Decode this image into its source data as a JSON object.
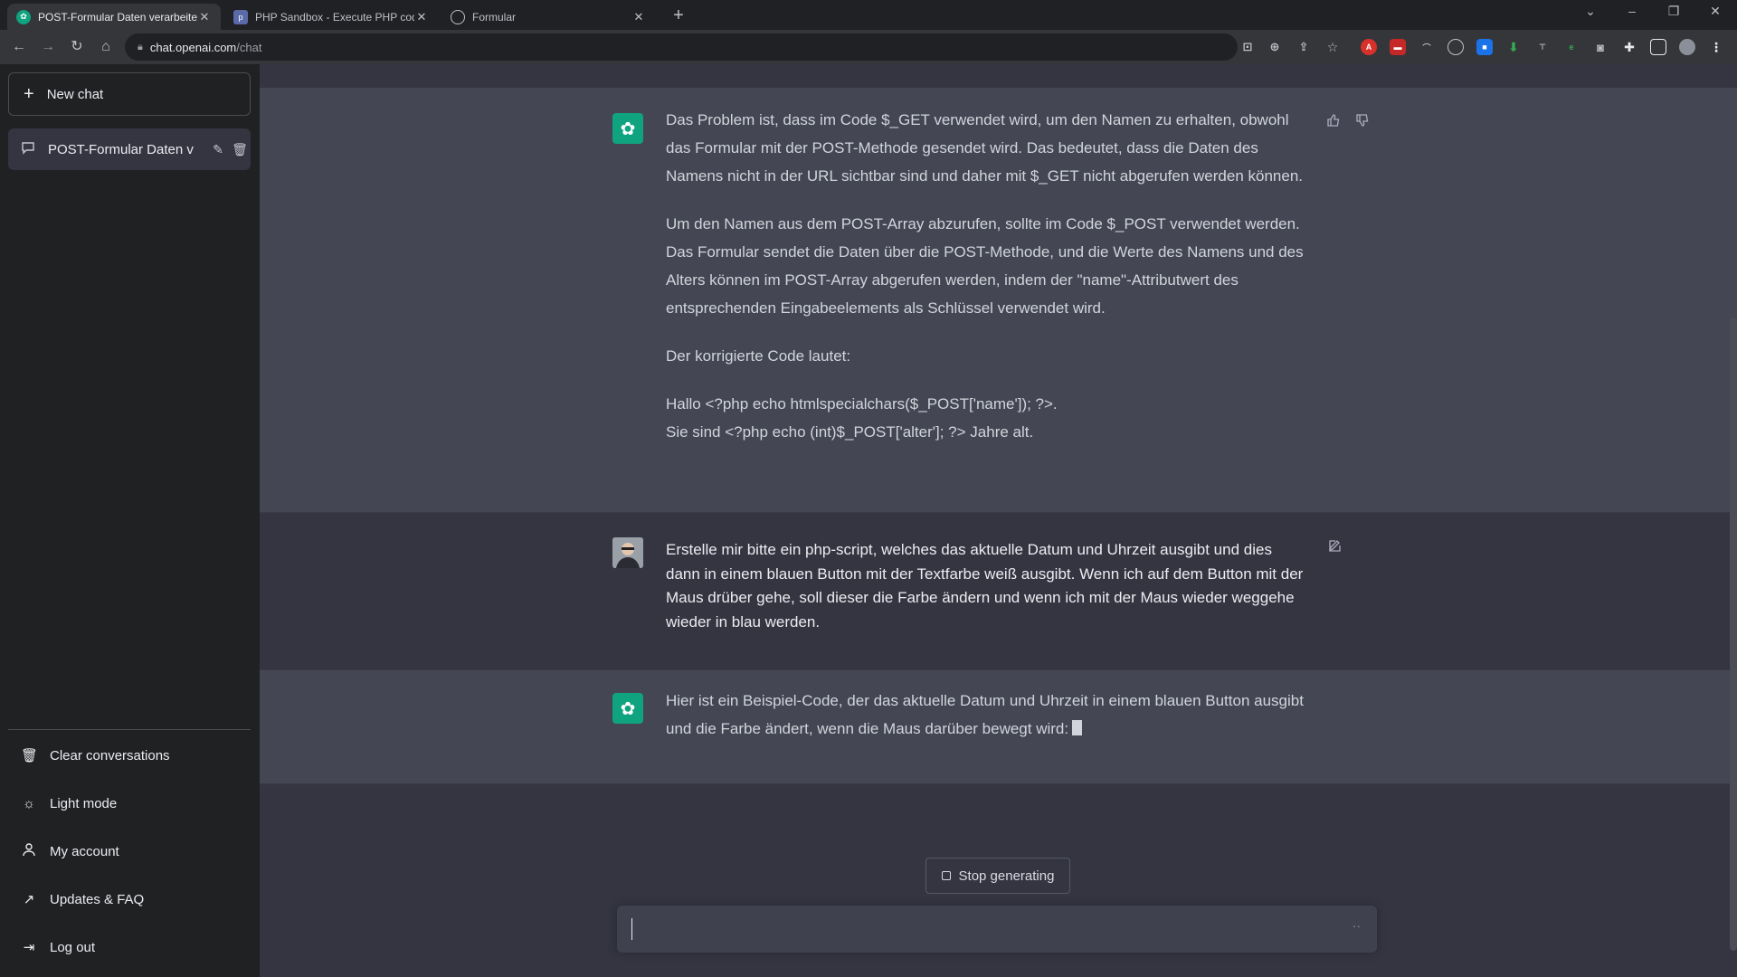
{
  "browser": {
    "tabs": [
      {
        "title": "POST-Formular Daten verarbeite",
        "active": true
      },
      {
        "title": "PHP Sandbox - Execute PHP cod",
        "active": false
      },
      {
        "title": "Formular",
        "active": false
      }
    ],
    "url_host": "chat.openai.com",
    "url_path": "/chat"
  },
  "sidebar": {
    "new_chat_label": "New chat",
    "conversations": [
      {
        "label": "POST-Formular Daten v"
      }
    ],
    "links": [
      {
        "label": "Clear conversations",
        "icon": "trash-icon"
      },
      {
        "label": "Light mode",
        "icon": "sun-icon"
      },
      {
        "label": "My account",
        "icon": "user-icon"
      },
      {
        "label": "Updates & FAQ",
        "icon": "external-link-icon"
      },
      {
        "label": "Log out",
        "icon": "logout-icon"
      }
    ]
  },
  "messages": [
    {
      "role": "assistant",
      "paragraphs": [
        "Das Problem ist, dass im Code $_GET verwendet wird, um den Namen zu erhalten, obwohl das Formular mit der POST-Methode gesendet wird. Das bedeutet, dass die Daten des Namens nicht in der URL sichtbar sind und daher mit $_GET nicht abgerufen werden können.",
        "Um den Namen aus dem POST-Array abzurufen, sollte im Code $_POST verwendet werden. Das Formular sendet die Daten über die POST-Methode, und die Werte des Namens und des Alters können im POST-Array abgerufen werden, indem der \"name\"-Attributwert des entsprechenden Eingabeelements als Schlüssel verwendet wird.",
        "Der korrigierte Code lautet:"
      ],
      "code_line_1": "Hallo <?php echo htmlspecialchars($_POST['name']); ?>.",
      "code_line_2": "Sie sind <?php echo (int)$_POST['alter']; ?> Jahre alt."
    },
    {
      "role": "user",
      "text": "Erstelle mir bitte ein php-script, welches das aktuelle Datum und Uhrzeit ausgibt und dies dann in einem blauen Button mit der Textfarbe weiß ausgibt. Wenn ich auf dem Button mit der Maus drüber gehe, soll dieser die Farbe ändern und wenn ich mit der Maus wieder weggehe wieder in blau werden."
    },
    {
      "role": "assistant",
      "text": "Hier ist ein Beispiel-Code, der das aktuelle Datum und Uhrzeit in einem blauen Button ausgibt und die Farbe ändert, wenn die Maus darüber bewegt wird:"
    }
  ],
  "composer": {
    "stop_label": "Stop generating",
    "dots": "··"
  },
  "colors": {
    "sidebar_bg": "#202123",
    "main_bg": "#343541",
    "assistant_bg": "#444654",
    "accent": "#10a37f"
  }
}
